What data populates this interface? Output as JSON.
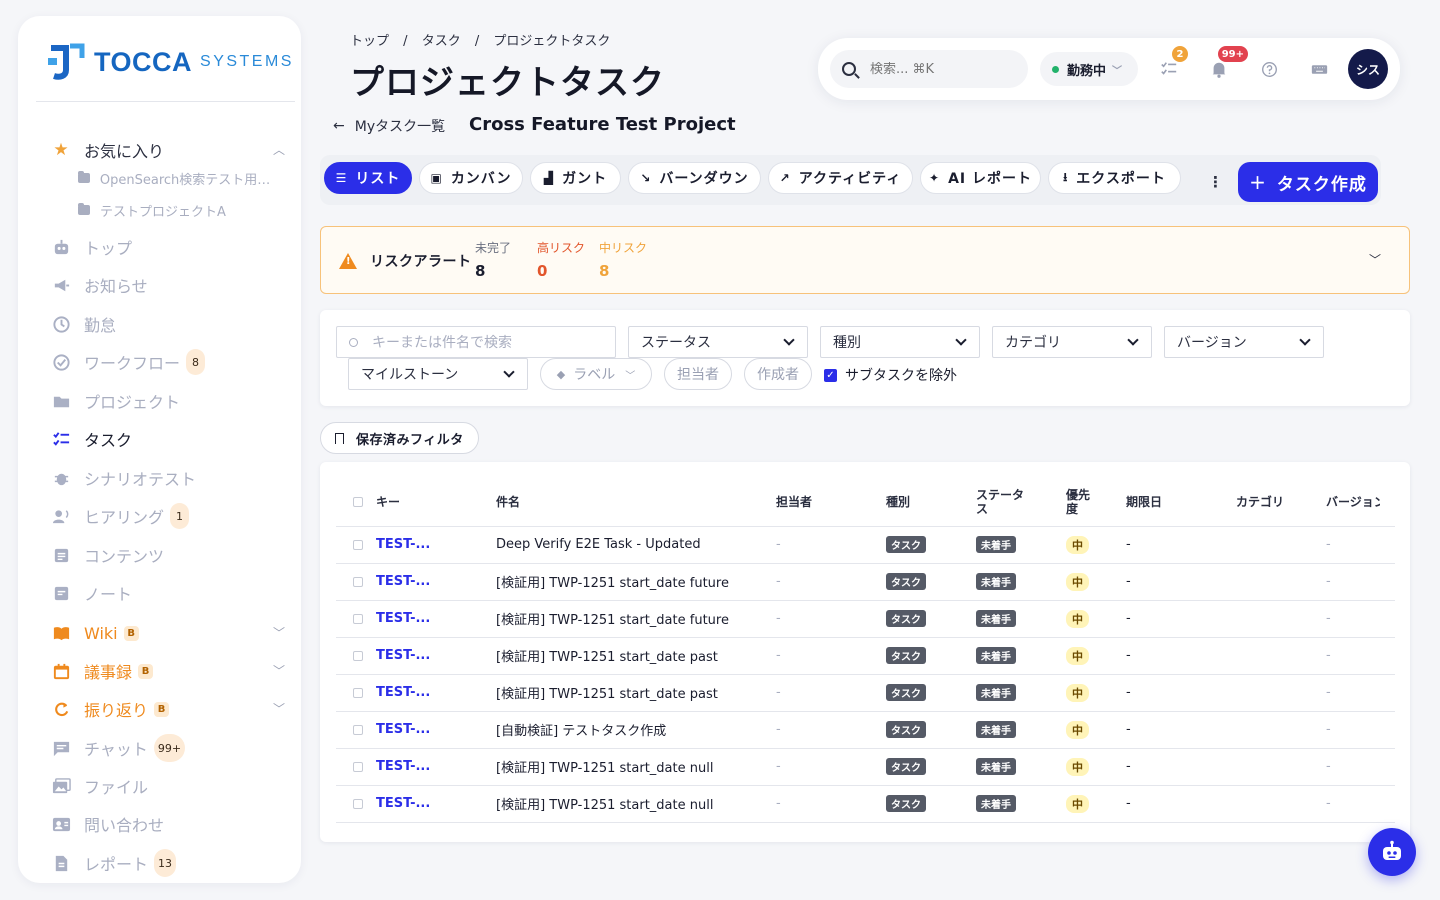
{
  "brand": {
    "main": "TOCCA",
    "sub": "SYSTEMS",
    "colors": {
      "primary": "#2b2ee8",
      "brand_blue": "#1566c0",
      "warning": "#ef8a1e"
    }
  },
  "sidebar": {
    "favorites": {
      "label": "お気に入り",
      "icon": "star-icon",
      "items": [
        "OpenSearch検索テスト用プ...",
        "テストプロジェクトA"
      ]
    },
    "items": [
      {
        "label": "トップ",
        "icon": "robot-icon"
      },
      {
        "label": "お知らせ",
        "icon": "megaphone-icon"
      },
      {
        "label": "勤怠",
        "icon": "clock-icon"
      },
      {
        "label": "ワークフロー",
        "icon": "check-circle-icon",
        "count": "8"
      },
      {
        "label": "プロジェクト",
        "icon": "folder-icon"
      },
      {
        "label": "タスク",
        "icon": "task-list-icon",
        "active": true
      },
      {
        "label": "シナリオテスト",
        "icon": "bug-icon"
      },
      {
        "label": "ヒアリング",
        "icon": "voice-icon",
        "count": "1"
      },
      {
        "label": "コンテンツ",
        "icon": "document-icon"
      },
      {
        "label": "ノート",
        "icon": "note-icon"
      },
      {
        "label": "Wiki",
        "icon": "book-icon",
        "badge": "B",
        "expandable": true
      },
      {
        "label": "議事録",
        "icon": "calendar-icon",
        "badge": "B",
        "expandable": true
      },
      {
        "label": "振り返り",
        "icon": "refresh-icon",
        "badge": "B",
        "expandable": true
      },
      {
        "label": "チャット",
        "icon": "chat-icon",
        "count": "99+"
      },
      {
        "label": "ファイル",
        "icon": "image-icon"
      },
      {
        "label": "問い合わせ",
        "icon": "contact-card-icon"
      },
      {
        "label": "レポート",
        "icon": "report-icon",
        "count": "13"
      }
    ]
  },
  "header": {
    "breadcrumb": [
      "トップ",
      "/",
      "タスク",
      "/",
      "プロジェクトタスク"
    ],
    "title": "プロジェクトタスク",
    "back_label": "Myタスク一覧",
    "project_name": "Cross Feature Test Project"
  },
  "topbar": {
    "search_placeholder": "検索... ⌘K",
    "status": "勤務中",
    "task_badge": "2",
    "notif_badge": "99+",
    "avatar": "シス"
  },
  "tabs": [
    {
      "label": "リスト",
      "icon": "list-icon",
      "active": true
    },
    {
      "label": "カンバン",
      "icon": "kanban-icon"
    },
    {
      "label": "ガント",
      "icon": "gantt-icon"
    },
    {
      "label": "バーンダウン",
      "icon": "burndown-icon"
    },
    {
      "label": "アクティビティ",
      "icon": "activity-icon"
    },
    {
      "label": "AI レポート",
      "icon": "sparkle-icon"
    },
    {
      "label": "エクスポート",
      "icon": "download-icon"
    }
  ],
  "create_label": "タスク作成",
  "risk": {
    "title": "リスクアラート",
    "metrics": [
      {
        "label": "未完了",
        "value": "8",
        "color": "#6b7080",
        "value_color": "#1a1d2e"
      },
      {
        "label": "高リスク",
        "value": "0",
        "color": "#e2552b",
        "value_color": "#e2552b"
      },
      {
        "label": "中リスク",
        "value": "8",
        "color": "#f0a33a",
        "value_color": "#f0a33a"
      }
    ]
  },
  "filters": {
    "search_placeholder": "キーまたは件名で検索",
    "status": "ステータス",
    "type": "種別",
    "category": "カテゴリ",
    "version": "バージョン",
    "milestone": "マイルストーン",
    "label": "ラベル",
    "assignee": "担当者",
    "creator": "作成者",
    "exclude_subtasks": "サブタスクを除外"
  },
  "saved_filter": "保存済みフィルタ",
  "table": {
    "headers": [
      "キー",
      "件名",
      "担当者",
      "種別",
      "ステータス",
      "優先度",
      "期限日",
      "カテゴリ",
      "バージョン"
    ],
    "rows": [
      {
        "key": "TEST-...",
        "subject": "Deep Verify E2E Task - Updated",
        "assignee": "-",
        "type": "タスク",
        "status": "未着手",
        "priority": "中",
        "due": "-",
        "category": "",
        "version": "-"
      },
      {
        "key": "TEST-...",
        "subject": "[検証用] TWP-1251 start_date future",
        "assignee": "-",
        "type": "タスク",
        "status": "未着手",
        "priority": "中",
        "due": "-",
        "category": "",
        "version": "-"
      },
      {
        "key": "TEST-...",
        "subject": "[検証用] TWP-1251 start_date future",
        "assignee": "-",
        "type": "タスク",
        "status": "未着手",
        "priority": "中",
        "due": "-",
        "category": "",
        "version": "-"
      },
      {
        "key": "TEST-...",
        "subject": "[検証用] TWP-1251 start_date past",
        "assignee": "-",
        "type": "タスク",
        "status": "未着手",
        "priority": "中",
        "due": "-",
        "category": "",
        "version": "-"
      },
      {
        "key": "TEST-...",
        "subject": "[検証用] TWP-1251 start_date past",
        "assignee": "-",
        "type": "タスク",
        "status": "未着手",
        "priority": "中",
        "due": "-",
        "category": "",
        "version": "-"
      },
      {
        "key": "TEST-...",
        "subject": "[自動検証] テストタスク作成",
        "assignee": "-",
        "type": "タスク",
        "status": "未着手",
        "priority": "中",
        "due": "-",
        "category": "",
        "version": "-"
      },
      {
        "key": "TEST-...",
        "subject": "[検証用] TWP-1251 start_date null",
        "assignee": "-",
        "type": "タスク",
        "status": "未着手",
        "priority": "中",
        "due": "-",
        "category": "",
        "version": "-"
      },
      {
        "key": "TEST-...",
        "subject": "[検証用] TWP-1251 start_date null",
        "assignee": "-",
        "type": "タスク",
        "status": "未着手",
        "priority": "中",
        "due": "-",
        "category": "",
        "version": "-"
      }
    ]
  },
  "fab_icon": "chatbot-icon"
}
